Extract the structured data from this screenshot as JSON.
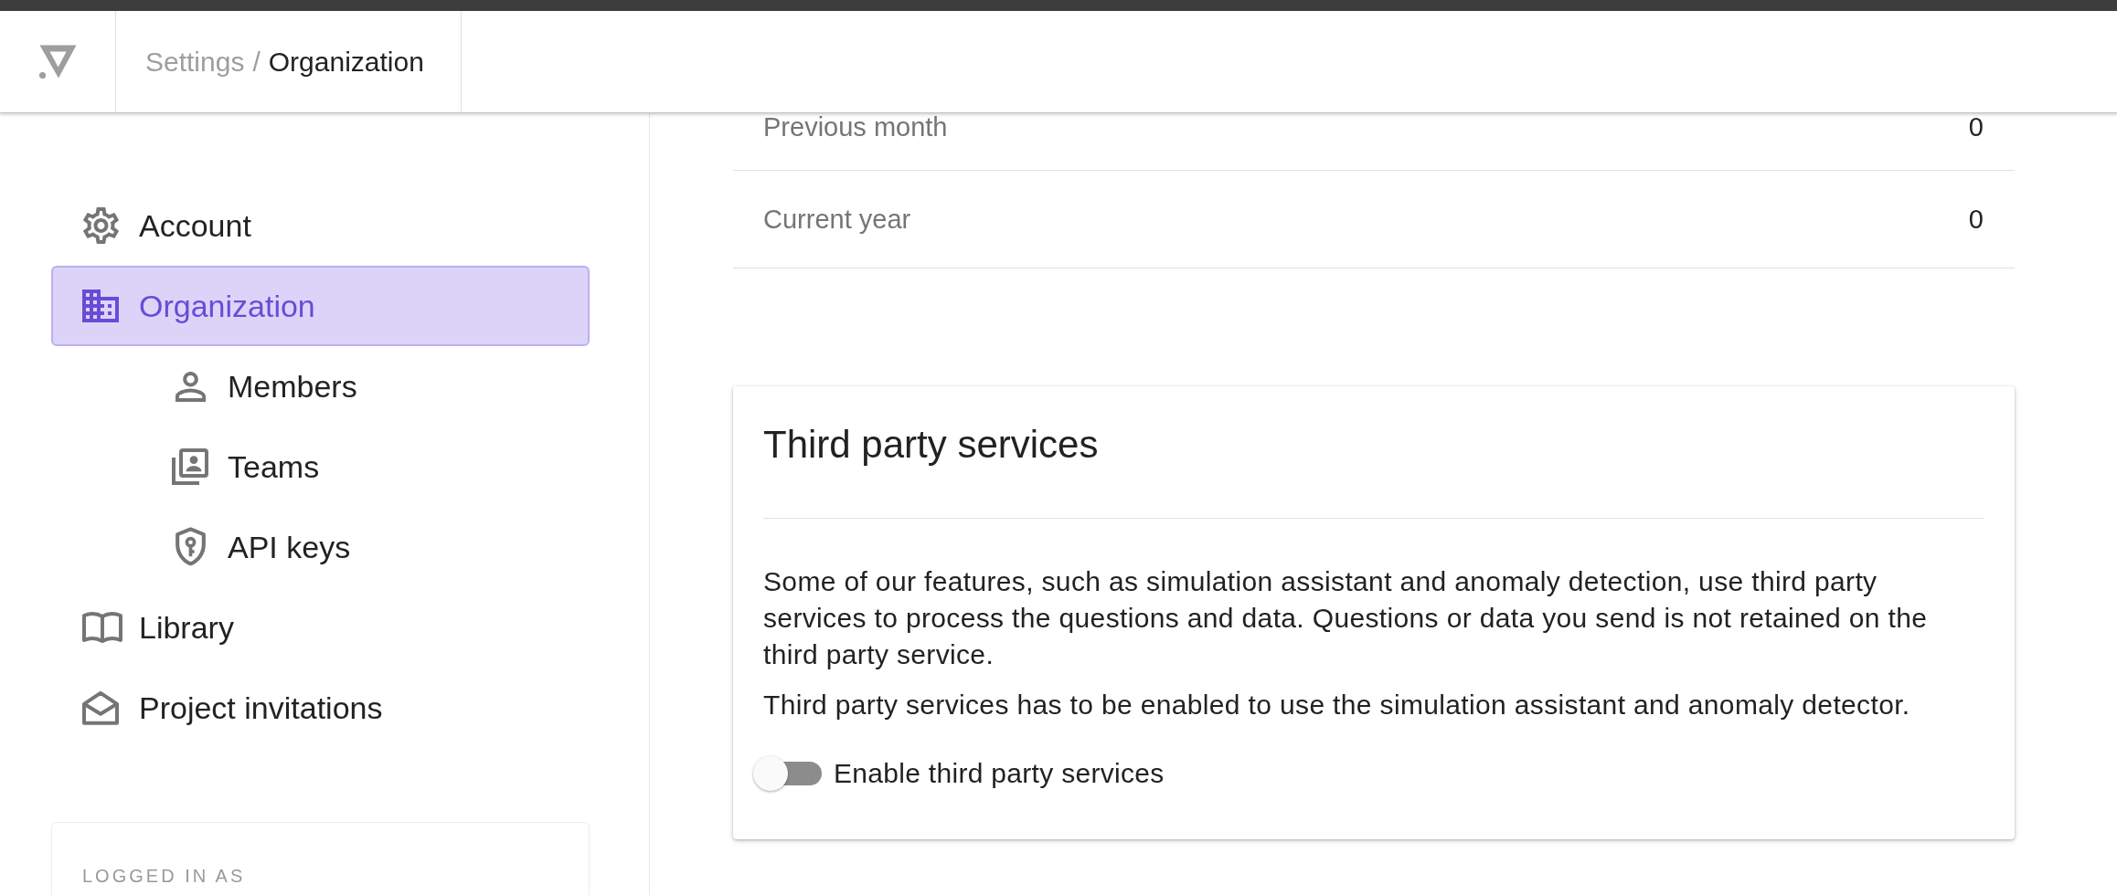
{
  "header": {
    "breadcrumb": [
      {
        "label": "Settings",
        "current": false
      },
      {
        "label": "Organization",
        "current": true
      }
    ],
    "separator": "/"
  },
  "sidebar": {
    "items": [
      {
        "label": "Account",
        "selected": false
      },
      {
        "label": "Organization",
        "selected": true,
        "children": [
          {
            "label": "Members",
            "selected": false
          },
          {
            "label": "Teams",
            "selected": false
          },
          {
            "label": "API keys",
            "selected": false
          }
        ]
      },
      {
        "label": "Library",
        "selected": false
      },
      {
        "label": "Project invitations",
        "selected": false
      }
    ],
    "account_card": {
      "heading": "LOGGED IN AS"
    }
  },
  "usage": {
    "rows": [
      {
        "label": "Previous month",
        "value": "0"
      },
      {
        "label": "Current year",
        "value": "0"
      }
    ]
  },
  "third_party": {
    "title": "Third party services",
    "paragraphs": [
      "Some of our features, such as simulation assistant and anomaly detection, use third party services to process the questions and data. Questions or data you send is not retained on the third party service.",
      "Third party services has to be enabled to use the simulation assistant and anomaly detector."
    ],
    "toggle": {
      "label": "Enable third party services",
      "on": false
    }
  }
}
